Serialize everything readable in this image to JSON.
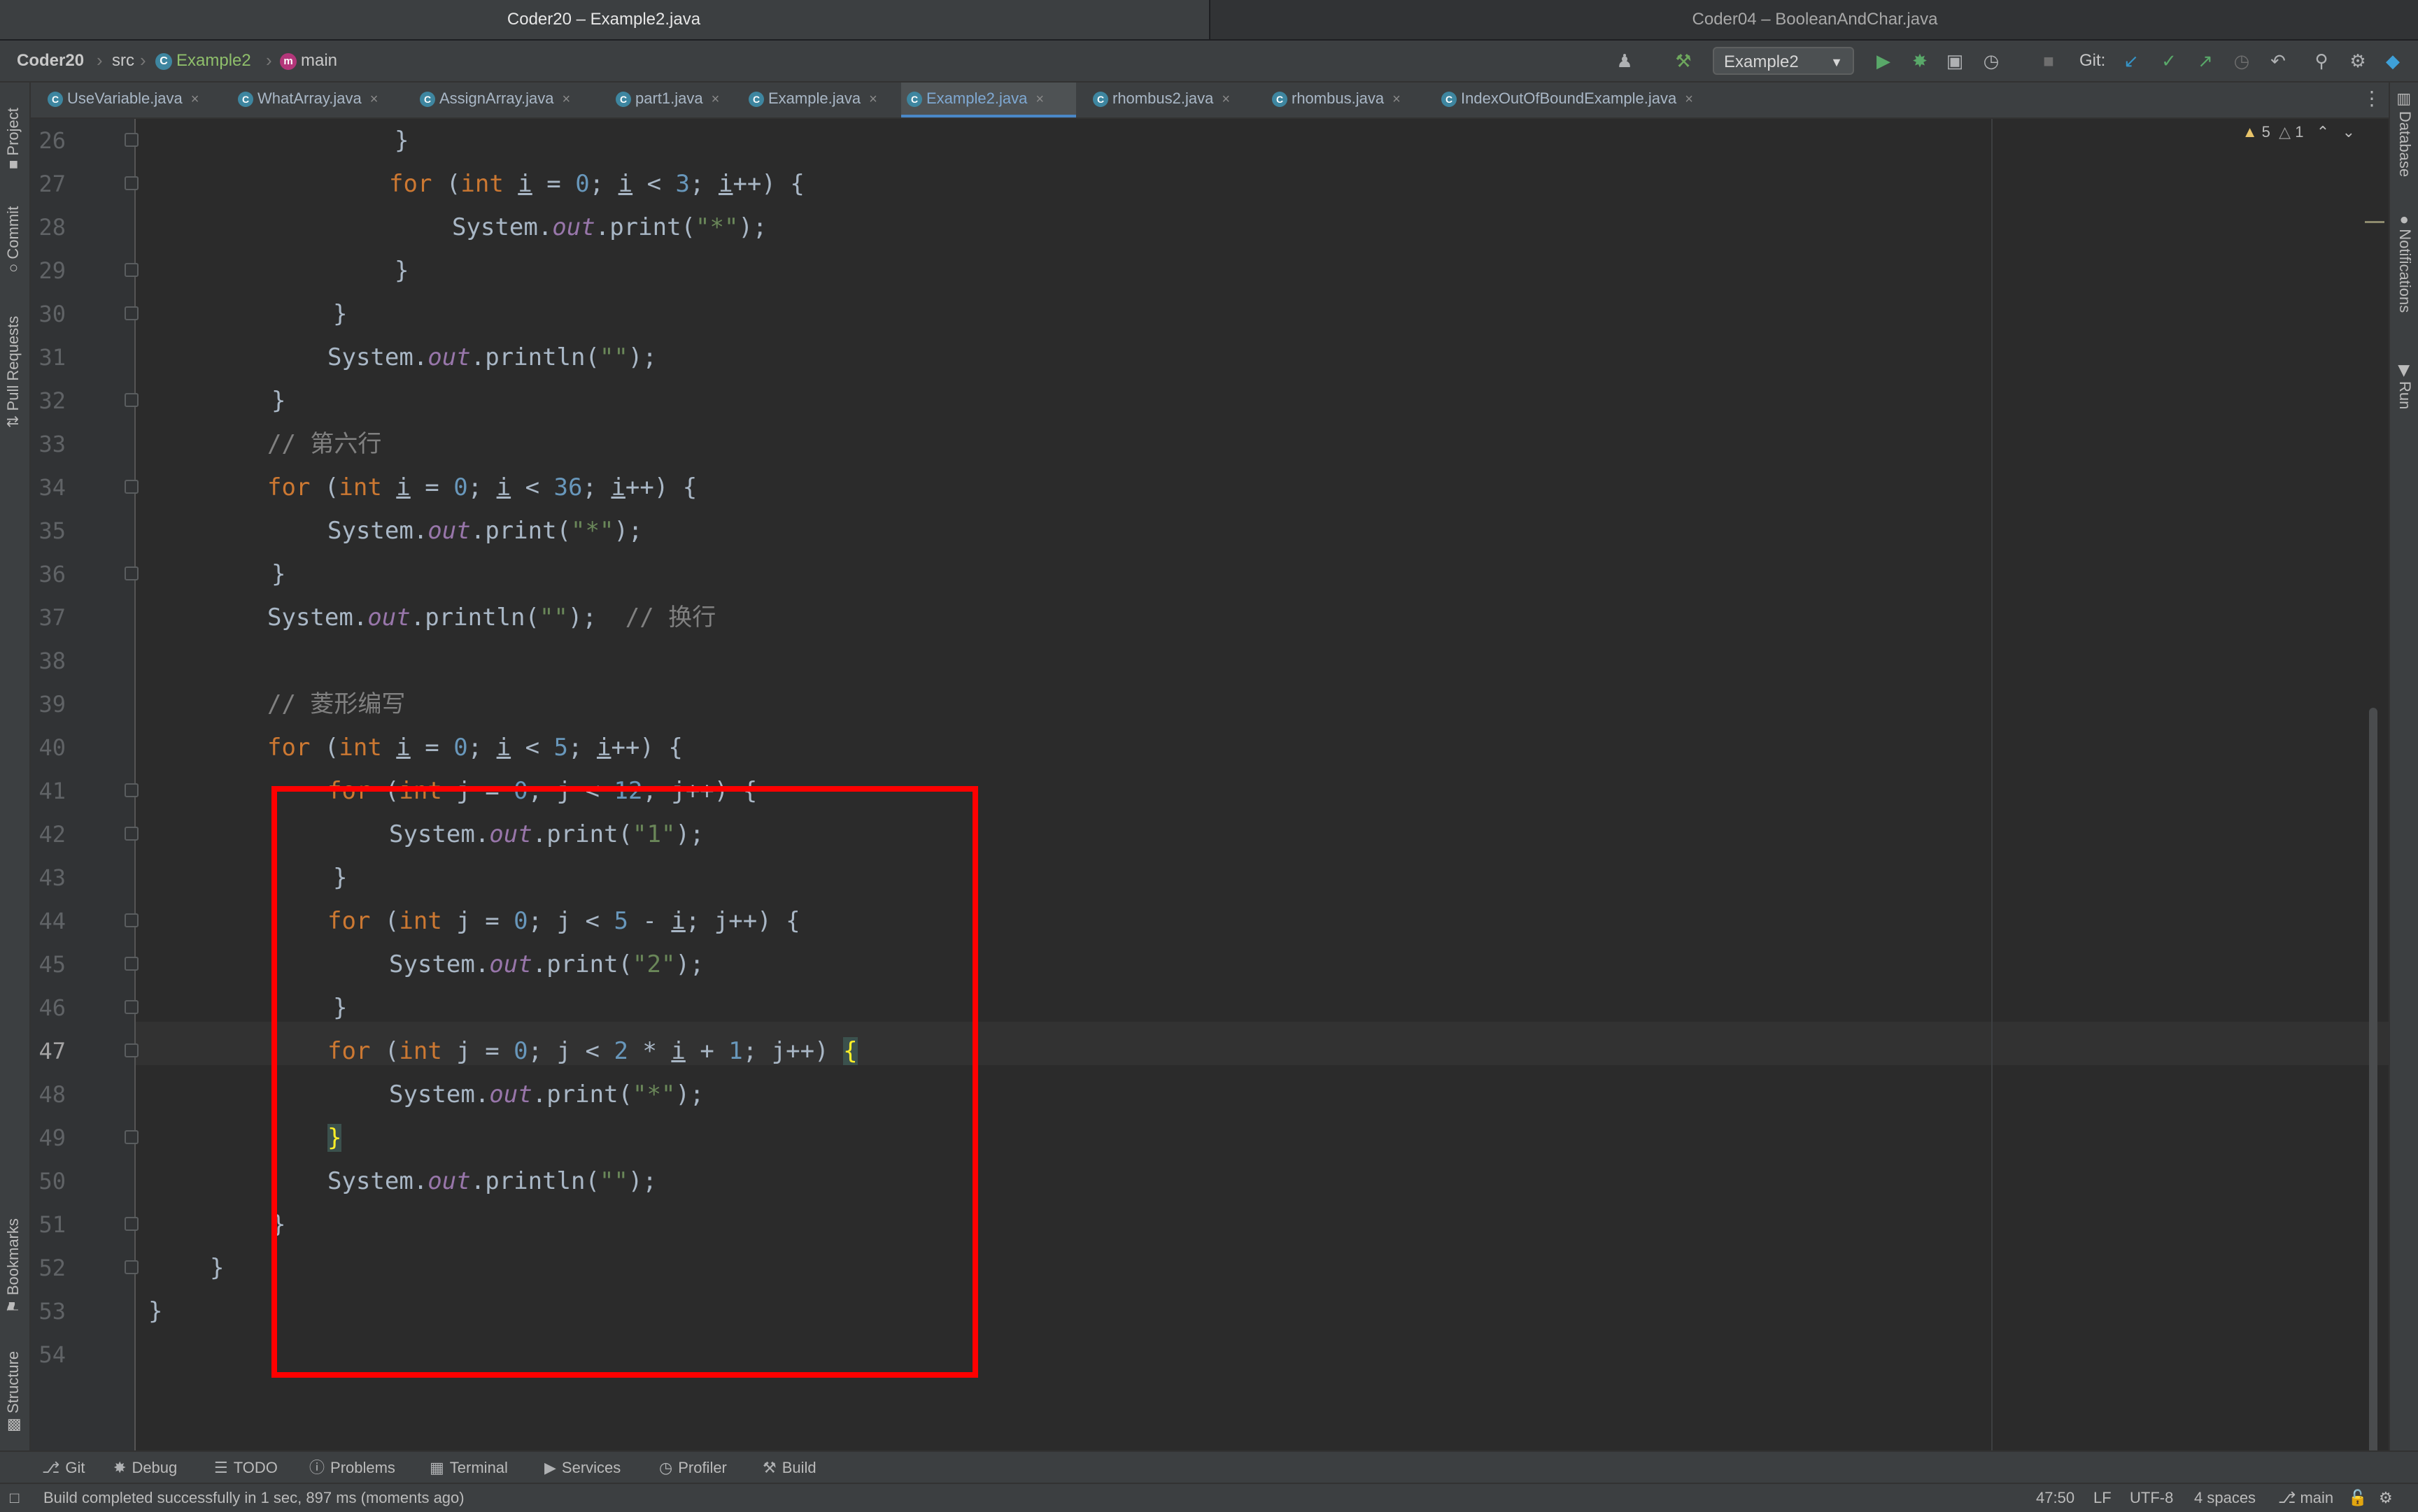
{
  "window_tabs": [
    "Coder20 – Example2.java",
    "Coder04 – BooleanAndChar.java"
  ],
  "breadcrumbs": {
    "project": "Coder20",
    "folder": "src",
    "class": "Example2",
    "method": "main"
  },
  "toolbar": {
    "run_config": "Example2",
    "git_label": "Git:"
  },
  "file_tabs": [
    "UseVariable.java",
    "WhatArray.java",
    "AssignArray.java",
    "part1.java",
    "Example.java",
    "Example2.java",
    "rhombus2.java",
    "rhombus.java",
    "IndexOutOfBoundExample.java"
  ],
  "active_tab": "Example2.java",
  "left_tools": [
    "Project",
    "Commit",
    "Pull Requests",
    "Bookmarks",
    "Structure"
  ],
  "right_tools": [
    "Database",
    "Notifications",
    "Run"
  ],
  "inspections": {
    "warnings": "5",
    "weak_warnings": "1"
  },
  "line_numbers": [
    "26",
    "27",
    "28",
    "29",
    "30",
    "31",
    "32",
    "33",
    "34",
    "35",
    "36",
    "37",
    "38",
    "39",
    "40",
    "41",
    "42",
    "43",
    "44",
    "45",
    "46",
    "47",
    "48",
    "49",
    "50",
    "51",
    "52",
    "53",
    "54"
  ],
  "code": {
    "comment_6": "// 第六行",
    "comment_newline": "// 换行",
    "comment_rhombus": "// 菱形编写",
    "str_star": "\"*\"",
    "str_empty": "\"\"",
    "str_1": "\"1\"",
    "str_2": "\"2\""
  },
  "bottom_tools": [
    "Git",
    "Debug",
    "TODO",
    "Problems",
    "Terminal",
    "Services",
    "Profiler",
    "Build"
  ],
  "status": {
    "message": "Build completed successfully in 1 sec, 897 ms (moments ago)",
    "position": "47:50",
    "line_sep": "LF",
    "encoding": "UTF-8",
    "indent": "4 spaces",
    "branch": "main"
  }
}
